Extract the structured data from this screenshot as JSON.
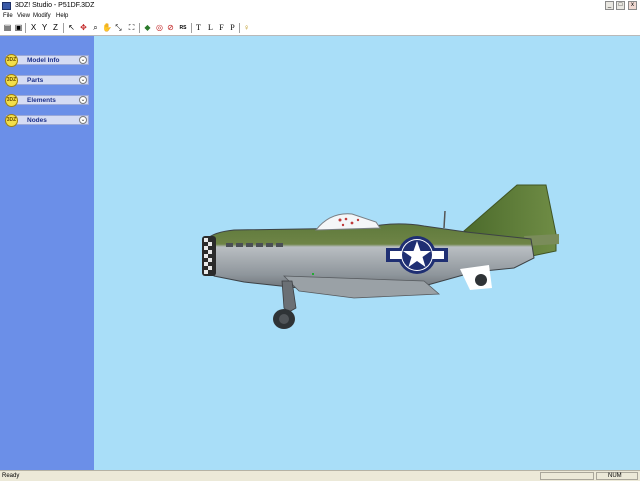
{
  "window": {
    "title": "3DZ! Studio - P51DF.3DZ",
    "minimize": "_",
    "maximize": "□",
    "close": "x"
  },
  "menu": {
    "items": [
      "File",
      "View",
      "Modify",
      "Help"
    ]
  },
  "toolbar": {
    "buttons": [
      {
        "icon": "open-icon",
        "glyph": "▤"
      },
      {
        "icon": "save-icon",
        "glyph": "▣"
      },
      {
        "icon": "rotate-x-icon",
        "glyph": "X"
      },
      {
        "icon": "rotate-y-icon",
        "glyph": "Y"
      },
      {
        "icon": "rotate-z-icon",
        "glyph": "Z"
      },
      {
        "icon": "select-icon",
        "glyph": "↖"
      },
      {
        "icon": "move-icon",
        "glyph": "✥"
      },
      {
        "icon": "zoom-icon",
        "glyph": "⌕"
      },
      {
        "icon": "pan-icon",
        "glyph": "✋"
      },
      {
        "icon": "scale-icon",
        "glyph": "⤡"
      },
      {
        "icon": "fit-icon",
        "glyph": "⛶"
      },
      {
        "icon": "texture-icon",
        "glyph": "◆"
      },
      {
        "icon": "wireframe-icon",
        "glyph": "◎"
      },
      {
        "icon": "hide-icon",
        "glyph": "⊘"
      },
      {
        "icon": "nodes-icon",
        "glyph": "⁂"
      },
      {
        "icon": "top-view-icon",
        "glyph": "T"
      },
      {
        "icon": "left-view-icon",
        "glyph": "L"
      },
      {
        "icon": "front-view-icon",
        "glyph": "F"
      },
      {
        "icon": "perspective-view-icon",
        "glyph": "P"
      },
      {
        "icon": "light-icon",
        "glyph": "♀"
      }
    ],
    "rs_label": "RS"
  },
  "sidebar": {
    "items": [
      {
        "label": "Model Info"
      },
      {
        "label": "Parts"
      },
      {
        "label": "Elements"
      },
      {
        "label": "Nodes"
      }
    ],
    "badge": "3DZ"
  },
  "viewport": {
    "background": "#a9def8",
    "model_name": "P-51D Mustang"
  },
  "status": {
    "text": "Ready",
    "indicator": "NUM"
  }
}
